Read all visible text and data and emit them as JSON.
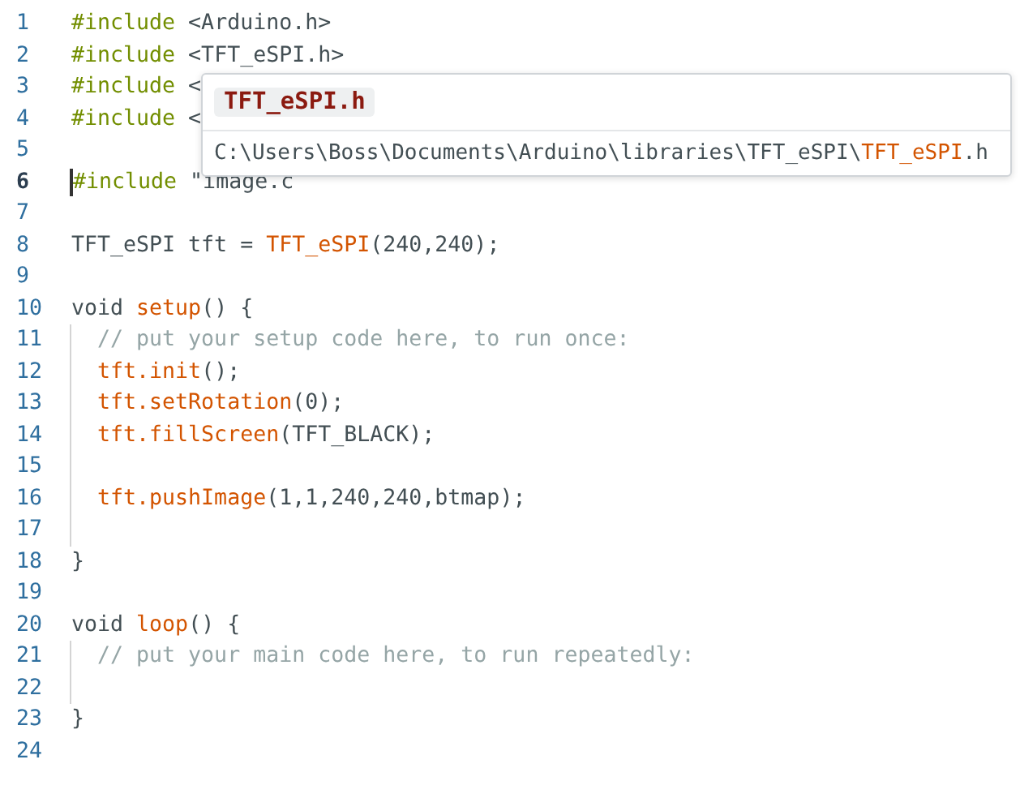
{
  "editor": {
    "lines": [
      {
        "number": "1",
        "current": false,
        "guide": false,
        "tokens": [
          {
            "text": "#include",
            "kind": "directive"
          },
          {
            "text": " <Arduino.h>",
            "kind": "plain"
          }
        ]
      },
      {
        "number": "2",
        "current": false,
        "guide": false,
        "tokens": [
          {
            "text": "#include",
            "kind": "directive"
          },
          {
            "text": " <TFT_eSPI.h>",
            "kind": "plain"
          }
        ]
      },
      {
        "number": "3",
        "current": false,
        "guide": false,
        "tokens": [
          {
            "text": "#include",
            "kind": "directive"
          },
          {
            "text": " <",
            "kind": "plain"
          }
        ]
      },
      {
        "number": "4",
        "current": false,
        "guide": false,
        "tokens": [
          {
            "text": "#include",
            "kind": "directive"
          },
          {
            "text": " <",
            "kind": "plain"
          }
        ]
      },
      {
        "number": "5",
        "current": false,
        "guide": false
      },
      {
        "number": "6",
        "current": true,
        "guide": false,
        "tokens": [
          {
            "text": "#include",
            "kind": "directive"
          },
          {
            "text": " \"image.c",
            "kind": "plain"
          }
        ]
      },
      {
        "number": "7",
        "current": false,
        "guide": false
      },
      {
        "number": "8",
        "current": false,
        "guide": false,
        "tokens": [
          {
            "text": "TFT_eSPI tft = ",
            "kind": "plain"
          },
          {
            "text": "TFT_eSPI",
            "kind": "func"
          },
          {
            "text": "(240,240);",
            "kind": "plain"
          }
        ]
      },
      {
        "number": "9",
        "current": false,
        "guide": false
      },
      {
        "number": "10",
        "current": false,
        "guide": false,
        "tokens": [
          {
            "text": "void ",
            "kind": "keyword"
          },
          {
            "text": "setup",
            "kind": "func"
          },
          {
            "text": "() {",
            "kind": "plain"
          }
        ]
      },
      {
        "number": "11",
        "current": false,
        "guide": true,
        "tokens": [
          {
            "text": "  // put your setup code here, to run once:",
            "kind": "comment"
          }
        ]
      },
      {
        "number": "12",
        "current": false,
        "guide": true,
        "tokens": [
          {
            "text": "  tft.init",
            "kind": "func"
          },
          {
            "text": "();",
            "kind": "plain"
          }
        ]
      },
      {
        "number": "13",
        "current": false,
        "guide": true,
        "tokens": [
          {
            "text": "  tft.setRotation",
            "kind": "func"
          },
          {
            "text": "(0);",
            "kind": "plain"
          }
        ]
      },
      {
        "number": "14",
        "current": false,
        "guide": true,
        "tokens": [
          {
            "text": "  tft.fillScreen",
            "kind": "func"
          },
          {
            "text": "(TFT_BLACK);",
            "kind": "plain"
          }
        ]
      },
      {
        "number": "15",
        "current": false,
        "guide": true
      },
      {
        "number": "16",
        "current": false,
        "guide": true,
        "tokens": [
          {
            "text": "  tft.pushImage",
            "kind": "func"
          },
          {
            "text": "(1,1,240,240,btmap);",
            "kind": "plain"
          }
        ]
      },
      {
        "number": "17",
        "current": false,
        "guide": true
      },
      {
        "number": "18",
        "current": false,
        "guide": false,
        "tokens": [
          {
            "text": "}",
            "kind": "plain"
          }
        ]
      },
      {
        "number": "19",
        "current": false,
        "guide": false
      },
      {
        "number": "20",
        "current": false,
        "guide": false,
        "tokens": [
          {
            "text": "void ",
            "kind": "keyword"
          },
          {
            "text": "loop",
            "kind": "func"
          },
          {
            "text": "() {",
            "kind": "plain"
          }
        ]
      },
      {
        "number": "21",
        "current": false,
        "guide": true,
        "tokens": [
          {
            "text": "  // put your main code here, to run repeatedly:",
            "kind": "comment"
          }
        ]
      },
      {
        "number": "22",
        "current": false,
        "guide": true
      },
      {
        "number": "23",
        "current": false,
        "guide": false,
        "tokens": [
          {
            "text": "}",
            "kind": "plain"
          }
        ]
      },
      {
        "number": "24",
        "current": false,
        "guide": false
      }
    ]
  },
  "hover": {
    "title": "TFT_eSPI.h",
    "path": [
      {
        "text": "C:\\Users\\Boss\\Documents\\Arduino\\libraries\\TFT_eSPI\\",
        "kind": "dir"
      },
      {
        "text": "TFT_eSPI",
        "kind": "name"
      },
      {
        "text": ".h",
        "kind": "dir"
      }
    ]
  }
}
